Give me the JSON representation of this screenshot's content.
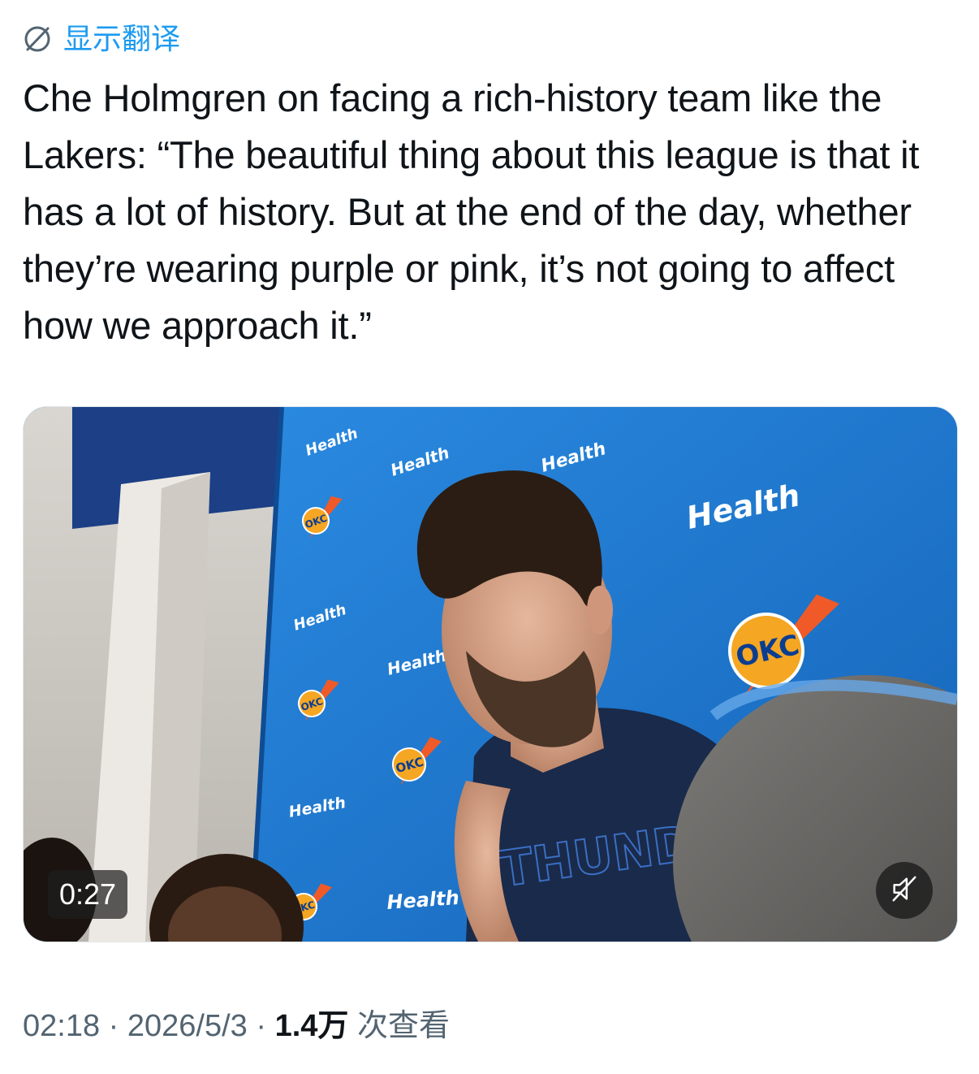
{
  "translate": {
    "label": "显示翻译",
    "icon": "globe-translate-icon",
    "color": "#1d9bf0"
  },
  "tweet": {
    "text": "Che Holmgren on facing a rich-history team like the Lakers: “The beautiful thing about this league is that it has a lot of history. But at the end of the day, whether they’re wearing purple or pink, it’s not going to affect how we approach it.”"
  },
  "media": {
    "type": "video",
    "duration": "0:27",
    "mute_icon": "speaker-muted-icon",
    "backdrop_texts": {
      "health": "Health",
      "okc": "OKC",
      "jersey": "THUNDER"
    }
  },
  "meta": {
    "time": "02:18",
    "separator": " · ",
    "date": "2026/5/3",
    "views": "1.4万",
    "views_label": " 次查看"
  },
  "colors": {
    "text": "#0f1419",
    "secondary": "#536471",
    "link": "#1d9bf0",
    "backdrop_blue": "#1d7ad1"
  }
}
